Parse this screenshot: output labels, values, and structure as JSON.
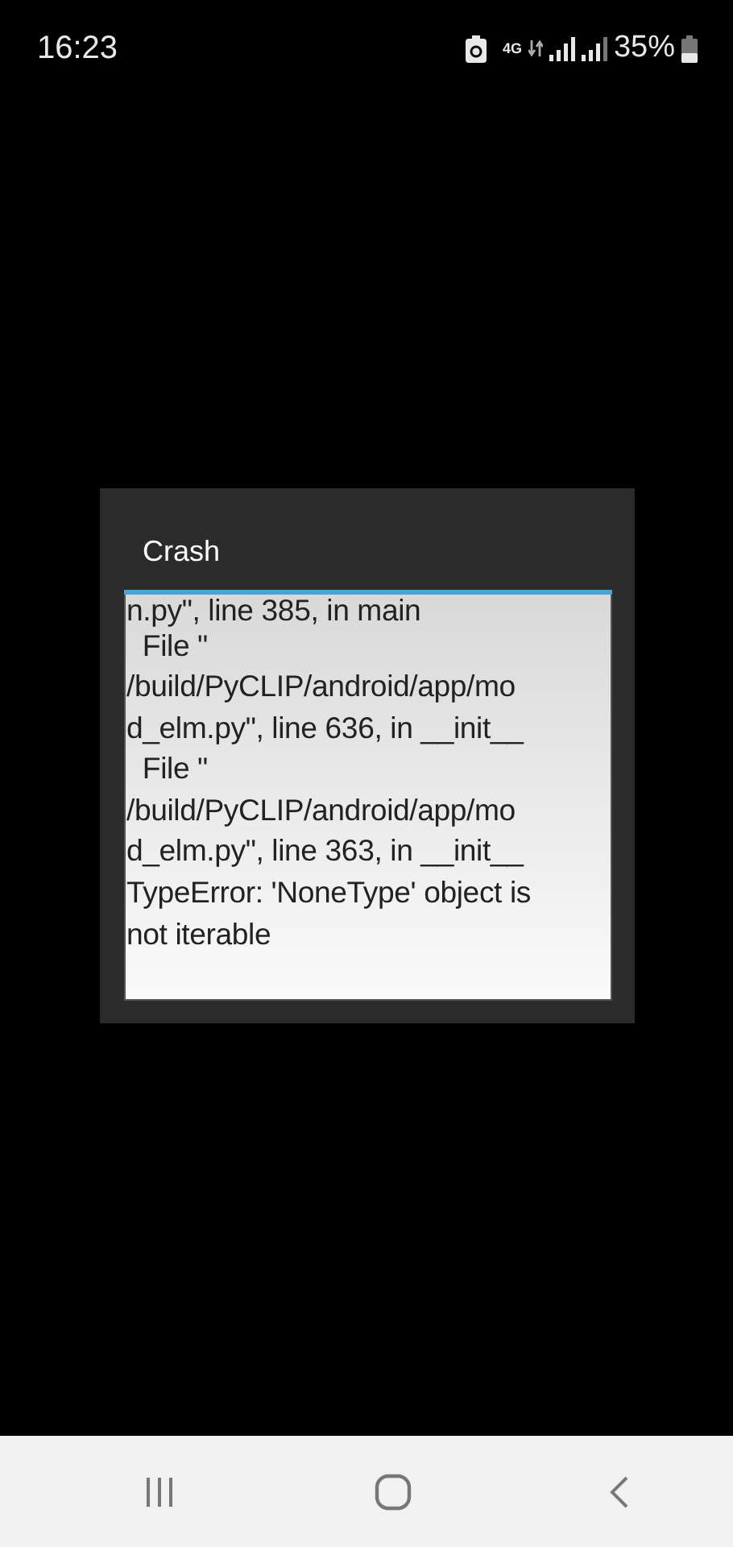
{
  "status_bar": {
    "time": "16:23",
    "network": "4G",
    "battery": "35%"
  },
  "dialog": {
    "title": "Crash",
    "lines": [
      "n.py\", line 385, in main",
      "  File \"",
      "/build/PyCLIP/android/app/mo",
      "d_elm.py\", line 636, in __init__",
      "  File \"",
      "/build/PyCLIP/android/app/mo",
      "d_elm.py\", line 363, in __init__",
      "TypeError: 'NoneType' object is",
      "not iterable"
    ]
  },
  "nav_bar": {
    "buttons": [
      {
        "kind": "recents"
      },
      {
        "kind": "home"
      },
      {
        "kind": "back"
      }
    ]
  }
}
